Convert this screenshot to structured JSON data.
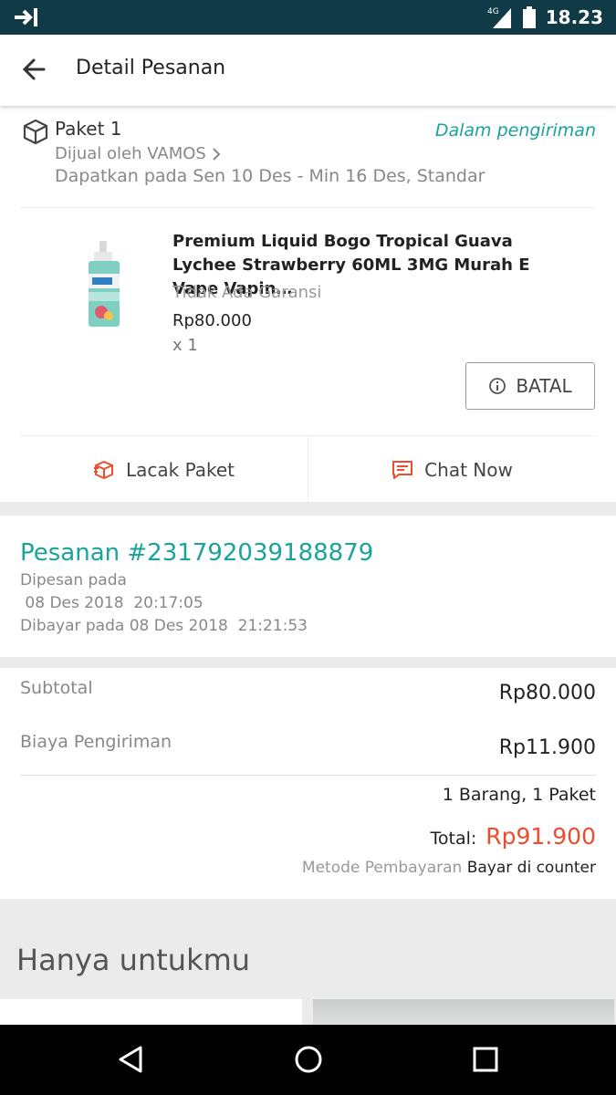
{
  "status_bar": {
    "network": "4G",
    "time": "18.23"
  },
  "app_bar": {
    "title": "Detail Pesanan"
  },
  "package": {
    "title": "Paket 1",
    "status": "Dalam pengiriman",
    "seller": "Dijual oleh VAMOS",
    "eta": "Dapatkan pada Sen 10 Des - Min 16 Des, Standar",
    "product": {
      "name": "Premium Liquid Bogo Tropical Guava Lychee Strawberry 60ML 3MG Murah E Vape Vapin…",
      "warranty": "Tidak Ada Garansi",
      "price": "Rp80.000",
      "quantity": "x 1"
    },
    "cancel_label": "BATAL",
    "track_label": "Lacak Paket",
    "chat_label": "Chat Now"
  },
  "order": {
    "number": "Pesanan #231792039188879",
    "ordered_label": "Dipesan pada",
    "ordered_at": " 08 Des 2018  20:17:05",
    "paid_at": "Dibayar pada 08 Des 2018  21:21:53"
  },
  "summary": {
    "subtotal_label": "Subtotal",
    "subtotal_value": "Rp80.000",
    "shipping_label": "Biaya Pengiriman",
    "shipping_value": "Rp11.900",
    "count": "1 Barang, 1 Paket",
    "total_label": "Total:",
    "total_value": "Rp91.900",
    "payment_label": "Metode Pembayaran",
    "payment_value": "Bayar di counter"
  },
  "for_you": {
    "title": "Hanya untukmu"
  },
  "colors": {
    "status_bar": "#0f3a46",
    "accent_teal": "#1aa39a",
    "accent_orange": "#ee4d2d"
  },
  "icons": [
    "cast-icon",
    "signal-icon",
    "battery-icon",
    "back-arrow-icon",
    "package-box-icon",
    "chevron-right-icon",
    "info-icon",
    "track-package-icon",
    "chat-icon",
    "nav-back-icon",
    "nav-home-icon",
    "nav-recents-icon"
  ]
}
